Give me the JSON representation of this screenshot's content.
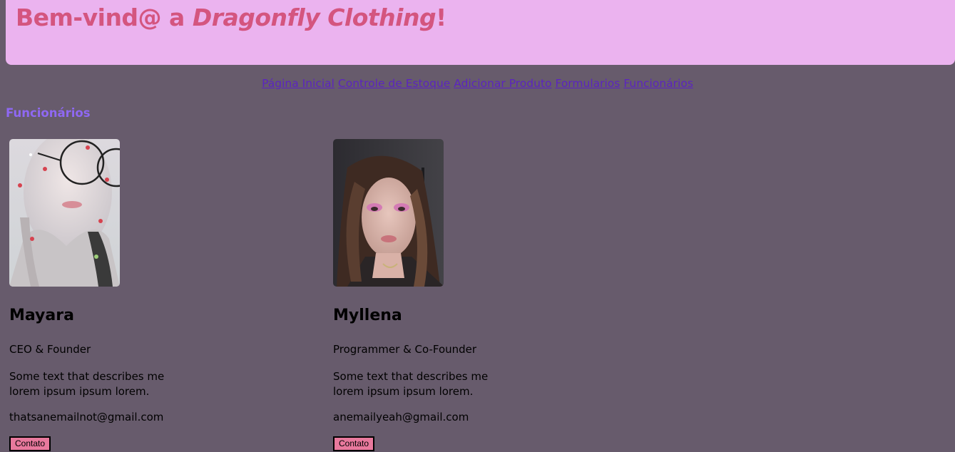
{
  "header": {
    "title_prefix": "Bem-vind@ a ",
    "title_brand": "Dragonfly Clothing",
    "title_suffix": "!"
  },
  "nav": {
    "items": [
      {
        "label": "Página Inicial"
      },
      {
        "label": "Controle de Estoque"
      },
      {
        "label": "Adicionar Produto"
      },
      {
        "label": "Formularios"
      },
      {
        "label": "Funcionários"
      }
    ]
  },
  "section": {
    "title": "Funcionários"
  },
  "employees": [
    {
      "name": "Mayara",
      "role": "CEO & Founder",
      "description": "Some text that describes me lorem ipsum ipsum lorem.",
      "email": "thatsanemailnot@gmail.com",
      "button": "Contato"
    },
    {
      "name": "Myllena",
      "role": "Programmer & Co-Founder",
      "description": "Some text that describes me lorem ipsum ipsum lorem.",
      "email": "anemailyeah@gmail.com",
      "button": "Contato"
    }
  ],
  "colors": {
    "background": "#675b6c",
    "header": "#ebb3ef",
    "title": "#d4557f",
    "link": "#5b24c0",
    "section_title": "#8f68f3",
    "button": "#e8799d"
  }
}
